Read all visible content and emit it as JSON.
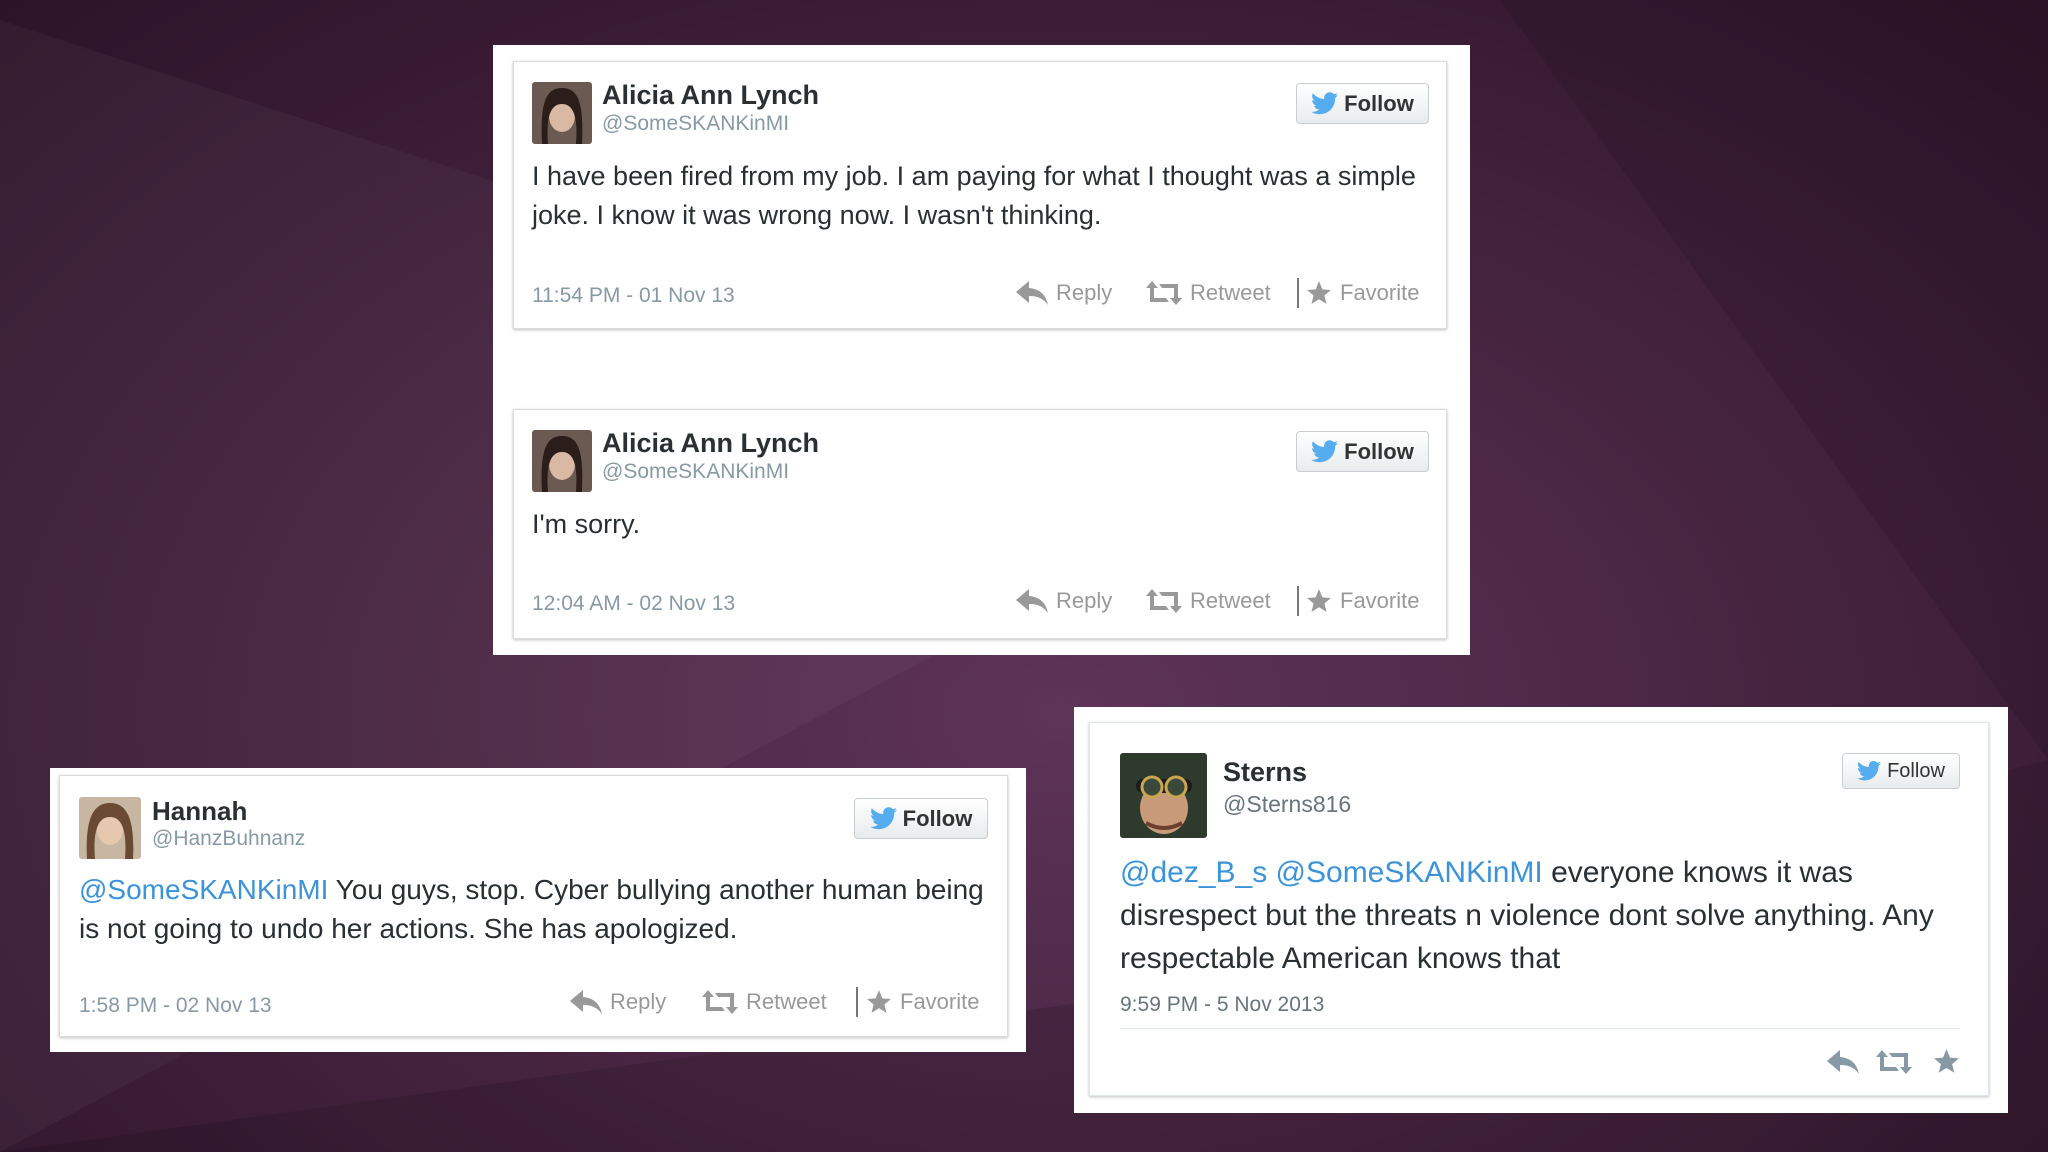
{
  "tweets": [
    {
      "name": "Alicia Ann Lynch",
      "handle": "@SomeSKANKinMI",
      "follow": "Follow",
      "text": "I have been fired from my job. I am paying for what I thought was a simple joke. I know it was wrong now. I wasn't thinking.",
      "timestamp": "11:54 PM - 01 Nov 13",
      "reply": "Reply",
      "retweet": "Retweet",
      "favorite": "Favorite"
    },
    {
      "name": "Alicia Ann Lynch",
      "handle": "@SomeSKANKinMI",
      "follow": "Follow",
      "text": "I'm sorry.",
      "timestamp": "12:04 AM - 02 Nov 13",
      "reply": "Reply",
      "retweet": "Retweet",
      "favorite": "Favorite"
    },
    {
      "name": "Hannah",
      "handle": "@HanzBuhnanz",
      "follow": "Follow",
      "mention": "@SomeSKANKinMI",
      "text": " You guys, stop. Cyber bullying another human being is not going to undo her actions. She has apologized.",
      "timestamp": "1:58 PM - 02 Nov 13",
      "reply": "Reply",
      "retweet": "Retweet",
      "favorite": "Favorite"
    },
    {
      "name": "Sterns",
      "handle": "@Sterns816",
      "follow": "Follow",
      "mention1": "@dez_B_s",
      "mention2": "@SomeSKANKinMI",
      "text": " everyone knows it was disrespect but the threats n violence dont solve anything. Any respectable American knows that",
      "timestamp": "9:59 PM - 5 Nov 2013"
    }
  ],
  "icons": {
    "bird": "twitter-bird-icon",
    "reply": "reply-arrow-icon",
    "retweet": "retweet-icon",
    "favorite": "star-icon"
  },
  "colors": {
    "twitter_blue": "#55acee",
    "mention_blue": "#3b94d9",
    "background": "#4a2744"
  }
}
